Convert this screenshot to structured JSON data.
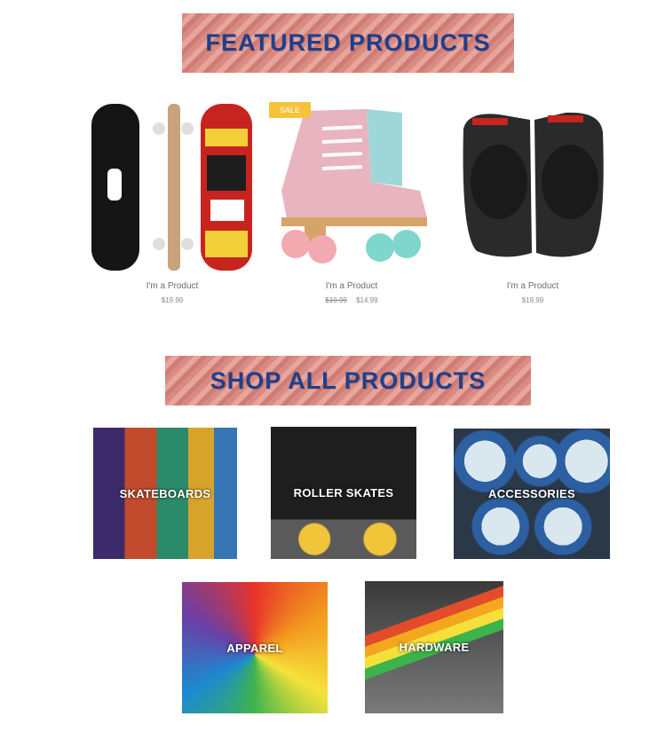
{
  "featured": {
    "title": "FEATURED PRODUCTS",
    "products": [
      {
        "name": "I'm a Product",
        "price": "$19.99"
      },
      {
        "name": "I'm a Product",
        "old_price": "$19.99",
        "price": "$14.99",
        "badge": "SALE"
      },
      {
        "name": "I'm a Product",
        "price": "$19.99"
      }
    ]
  },
  "shop_all": {
    "title": "SHOP ALL PRODUCTS",
    "categories": [
      {
        "label": "SKATEBOARDS"
      },
      {
        "label": "ROLLER SKATES"
      },
      {
        "label": "ACCESSORIES"
      },
      {
        "label": "APPAREL"
      },
      {
        "label": "HARDWARE"
      }
    ]
  },
  "colors": {
    "banner_text": "#1f3f8c",
    "banner_bg": "#d98a82",
    "sale_badge": "#f6c23a"
  }
}
